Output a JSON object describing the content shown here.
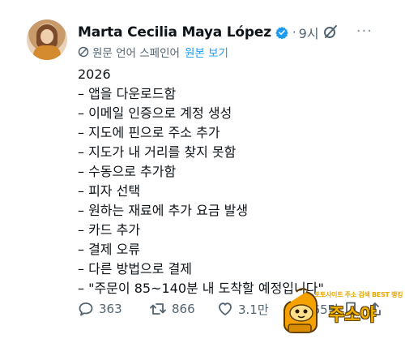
{
  "user": {
    "name": "Marta Cecilia Maya López",
    "time": "9시",
    "separator": "·"
  },
  "translation": {
    "label": "원문 언어 스페인어",
    "show_original": "원본 보기"
  },
  "tweet_lines": [
    "2026",
    "– 앱을 다운로드함",
    "– 이메일 인증으로 계정 생성",
    "– 지도에 핀으로 주소 추가",
    "– 지도가 내 거리를 찾지 못함",
    "– 수동으로 추가함",
    "– 피자 선택",
    "– 원하는 재료에 추가 요금 발생",
    "– 카드 추가",
    "– 결제 오류",
    "– 다른 방법으로 결제",
    "– \"주문이 85~140분 내 도착할 예정입니다\""
  ],
  "actions": {
    "replies": "363",
    "retweets": "866",
    "likes": "3.1만",
    "views": "265만"
  },
  "watermark": {
    "tagline": "토토사이트 주소 검색 BEST 랭킹",
    "name": "주소야"
  },
  "icons": {
    "verified": "verified-badge-icon",
    "translate": "translate-icon",
    "grok": "grok-icon",
    "more": "more-icon",
    "reply": "reply-icon",
    "retweet": "retweet-icon",
    "like": "heart-icon",
    "views": "views-icon",
    "bookmark": "bookmark-icon",
    "share": "share-icon"
  },
  "colors": {
    "accent": "#1d9bf0",
    "text": "#0f1419",
    "muted": "#536471",
    "watermark": "#f2b300"
  }
}
